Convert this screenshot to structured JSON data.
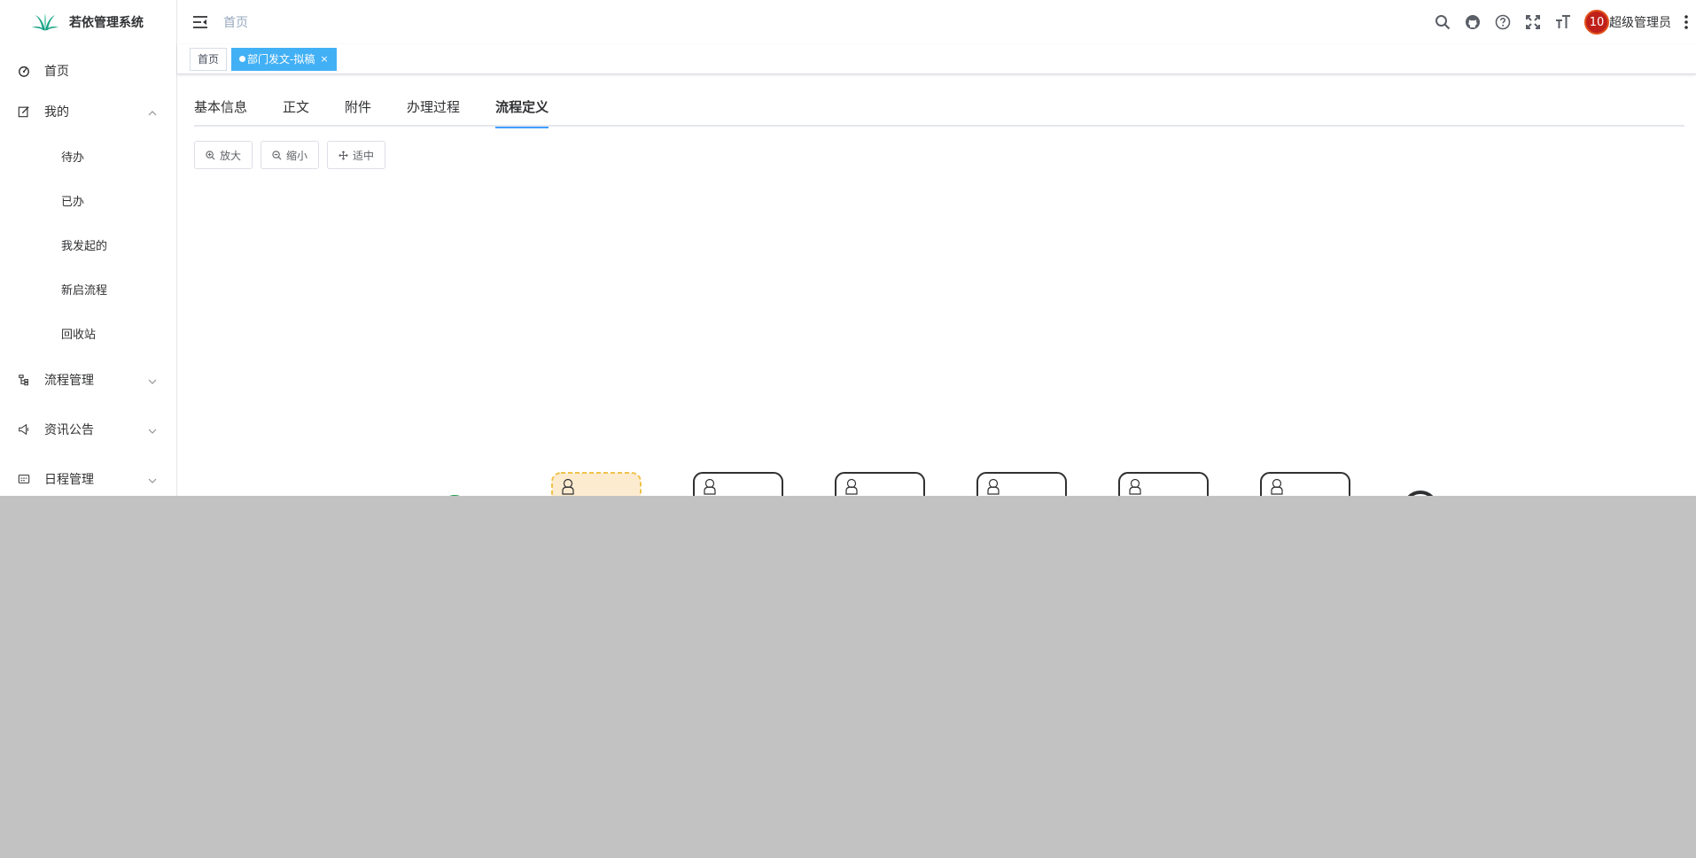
{
  "app": {
    "title": "若依管理系统"
  },
  "sidebar": {
    "items": [
      {
        "label": "首页",
        "icon": "dashboard-icon"
      },
      {
        "label": "我的",
        "icon": "edit-icon",
        "expanded": true,
        "children": [
          "待办",
          "已办",
          "我发起的",
          "新启流程",
          "回收站"
        ]
      },
      {
        "label": "流程管理",
        "icon": "tree-icon",
        "expanded": false
      },
      {
        "label": "资讯公告",
        "icon": "megaphone-icon",
        "expanded": false
      },
      {
        "label": "日程管理",
        "icon": "calendar-icon",
        "expanded": false
      }
    ]
  },
  "header": {
    "breadcrumb": "首页",
    "icons": [
      "search-icon",
      "github-icon",
      "help-icon",
      "fullscreen-icon",
      "font-size-icon"
    ],
    "avatar_text": "10",
    "username": "超级管理员"
  },
  "tags": [
    {
      "label": "首页",
      "active": false
    },
    {
      "label": "部门发文-拟稿",
      "active": true,
      "close": "×"
    }
  ],
  "tabs": [
    "基本信息",
    "正文",
    "附件",
    "办理过程",
    "流程定义"
  ],
  "active_tab": "流程定义",
  "toolbar": {
    "zoom_in": "放大",
    "zoom_out": "缩小",
    "fit": "适中"
  },
  "colors": {
    "accent": "#409eff",
    "tag_active": "#42b0f5",
    "current_task_fill": "#fdebd0",
    "current_task_border": "#f0c24a",
    "overlay": "#c2c2c2"
  }
}
